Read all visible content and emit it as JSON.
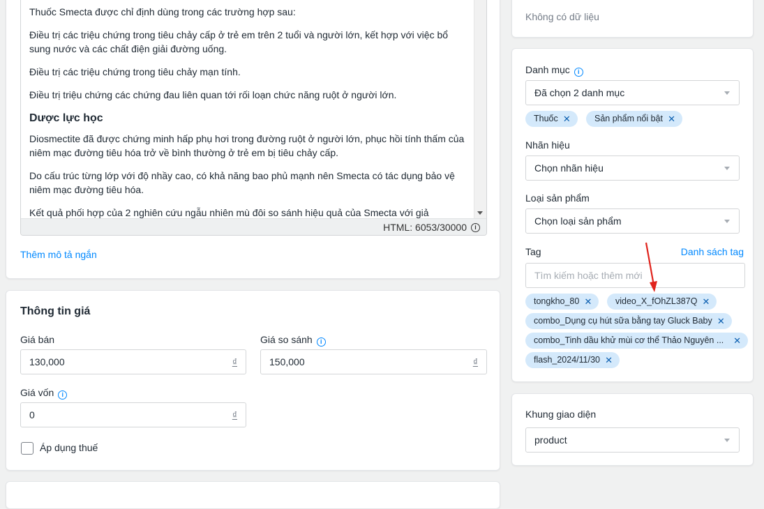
{
  "description": {
    "paragraphs_top": [
      "Thuốc Smecta được chỉ định dùng trong các trường hợp sau:",
      "Điều trị các triệu chứng trong tiêu chảy cấp ở trẻ em trên 2 tuổi và người lớn, kết hợp với việc bổ sung nước và các chất điện giải đường uống.",
      "Điều trị các triệu chứng trong tiêu chảy mạn tính.",
      "Điều trị triệu chứng các chứng đau liên quan tới rối loạn chức năng ruột ở người lớn."
    ],
    "heading": "Dược lực học",
    "paragraphs_bottom": [
      "Diosmectite đã được chứng minh hấp phụ hơi trong đường ruột ở người lớn, phục hồi tính thấm của niêm mạc đường tiêu hóa trở về bình thường ở trẻ em bị tiêu chảy cấp.",
      "Do cấu trúc từng lớp với độ nhầy cao, có khả năng bao phủ mạnh nên Smecta có tác dụng bảo vệ niêm mạc đường tiêu hóa.",
      "Kết quả phối hợp của 2 nghiên cứu ngẫu nhiên mù đôi so sánh hiệu quả của Smecta với giả"
    ],
    "html_counter": "HTML: 6053/30000",
    "add_short_desc_label": "Thêm mô tả ngắn"
  },
  "price": {
    "title": "Thông tin giá",
    "sell_label": "Giá bán",
    "sell_value": "130,000",
    "compare_label": "Giá so sánh",
    "compare_value": "150,000",
    "cost_label": "Giá vốn",
    "cost_value": "0",
    "currency": "₫",
    "tax_label": "Áp dụng thuế"
  },
  "nodata": {
    "text": "Không có dữ liệu"
  },
  "category": {
    "label": "Danh mục",
    "selected": "Đã chọn 2 danh mục",
    "chips": [
      "Thuốc",
      "Sản phẩm nổi bật"
    ]
  },
  "brand": {
    "label": "Nhãn hiệu",
    "placeholder": "Chọn nhãn hiệu"
  },
  "product_type": {
    "label": "Loại sản phẩm",
    "placeholder": "Chọn loại sản phẩm"
  },
  "tag": {
    "label": "Tag",
    "list_link": "Danh sách tag",
    "input_placeholder": "Tìm kiếm hoặc thêm mới",
    "chips": [
      "tongkho_80",
      "video_X_fOhZL387Q",
      "combo_Dụng cụ hút sữa bằng tay Gluck Baby",
      "combo_Tinh dầu khử mùi cơ thể Thảo Nguyên ...",
      "flash_2024/11/30"
    ]
  },
  "theme": {
    "label": "Khung giao diện",
    "selected": "product"
  },
  "colors": {
    "accent": "#0088ff",
    "chip_bg": "#d4e9fb",
    "annotation_arrow": "#e0231c"
  }
}
